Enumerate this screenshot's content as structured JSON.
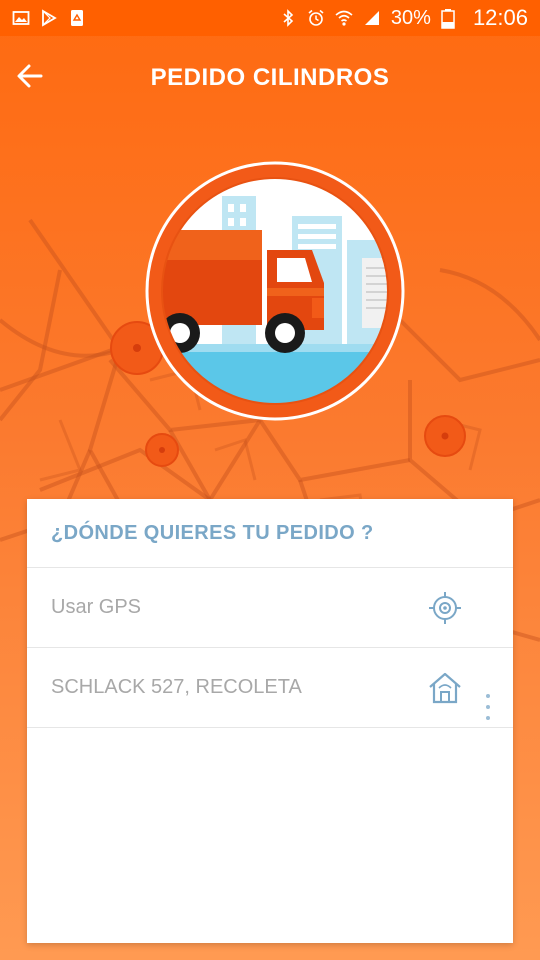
{
  "status_bar": {
    "battery_percent": "30%",
    "time": "12:06",
    "left_icons": [
      "image-icon",
      "play-store-icon",
      "recycle-icon"
    ],
    "right_icons": [
      "bluetooth-icon",
      "alarm-icon",
      "wifi-icon",
      "signal-icon",
      "battery-icon"
    ]
  },
  "app_bar": {
    "title": "PEDIDO CILINDROS",
    "back_icon": "arrow-left-icon"
  },
  "card": {
    "title": "¿DÓNDE QUIERES TU PEDIDO ?",
    "options": [
      {
        "label": "Usar GPS",
        "icon": "gps-target-icon"
      },
      {
        "label": "SCHLACK 527, RECOLETA",
        "icon": "home-icon"
      }
    ]
  },
  "colors": {
    "primary_orange": "#ff6000",
    "card_title": "#7aa7c7",
    "option_text": "#a8a8a8",
    "icon_blue": "#7aa7c7",
    "truck_orange": "#f05a16"
  }
}
